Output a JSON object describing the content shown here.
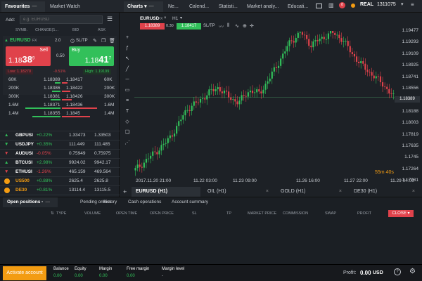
{
  "topbar": {
    "favourites": "Favourites",
    "market_watch": "Market Watch",
    "charts": "Charts",
    "tabs": [
      "Ne...",
      "Calend...",
      "Statisti...",
      "Market analy...",
      "Educati..."
    ],
    "account_type": "REAL",
    "account_number": "1311075",
    "notification_count": "8"
  },
  "left": {
    "add_label": "Add:",
    "search_placeholder": "e.g. EURUSD",
    "headers": [
      "SYMB.",
      "CHANGE(1...",
      "BID",
      "ASK"
    ],
    "ticket": {
      "symbol": "EURUSD",
      "fx": "FX",
      "volume": "2.0",
      "sltp": "SL/TP",
      "sell_label": "Sell",
      "sell_price_a": "1.18",
      "sell_price_b": "38",
      "sell_price_c": "9",
      "spread": "0.50",
      "buy_label": "Buy",
      "buy_price_a": "1.18",
      "buy_price_b": "41",
      "buy_price_c": "7",
      "low": "Low: 1.18270",
      "change": "-0.51%",
      "high": "High: 1.19199"
    },
    "depth": [
      {
        "vol": "60K",
        "bid": "1.18389",
        "ask": "1.18417",
        "vol2": "60K"
      },
      {
        "vol": "200K",
        "bid": "1.18386",
        "ask": "1.18422",
        "vol2": "200K"
      },
      {
        "vol": "300K",
        "bid": "1.18381",
        "ask": "1.18426",
        "vol2": "300K"
      },
      {
        "vol": "1.6M",
        "bid": "1.18371",
        "ask": "1.18436",
        "vol2": "1.6M"
      },
      {
        "vol": "1.4M",
        "bid": "1.18355",
        "ask": "1.1845",
        "vol2": "1.4M"
      }
    ],
    "instruments": [
      {
        "dir": "▲",
        "sym": "GBPUSI",
        "chg": "+0.22%",
        "bid": "1.33473",
        "ask": "1.33503",
        "color": "green"
      },
      {
        "dir": "▼",
        "sym": "USDJPY",
        "chg": "+0.35%",
        "bid": "111.449",
        "ask": "111.485",
        "color": "green"
      },
      {
        "dir": "▼",
        "sym": "AUDUSI",
        "chg": "-0.05%",
        "bid": "0.75949",
        "ask": "0.75975",
        "color": "red"
      },
      {
        "dir": "▲",
        "sym": "BTCUSI",
        "chg": "+2.98%",
        "bid": "9924.02",
        "ask": "9942.17",
        "color": "green"
      },
      {
        "dir": "▼",
        "sym": "ETHUSI",
        "chg": "-1.26%",
        "bid": "465.159",
        "ask": "469.564",
        "color": "red"
      },
      {
        "dir": "●",
        "sym": "US500",
        "chg": "+0.88%",
        "bid": "2625.4",
        "ask": "2625.8",
        "color": "green"
      },
      {
        "dir": "●",
        "sym": "DE30",
        "chg": "+0.81%",
        "bid": "13114.4",
        "ask": "13115.5",
        "color": "green"
      },
      {
        "dir": "●",
        "sym": "US100",
        "chg": "+1.12%",
        "bid": "6311.2",
        "ask": "6312.1",
        "color": "green"
      }
    ]
  },
  "chart": {
    "symbol": "EURUSD",
    "fx": "FX",
    "timeframe": "H1",
    "sell_price": "1.18389",
    "spread": "0.30",
    "buy_price": "1.18417",
    "sltp": "SL/TP",
    "y_ticks": [
      "1.19477",
      "1.19293",
      "1.19109",
      "1.18925",
      "1.18741",
      "1.18556",
      "1.18389",
      "1.18188",
      "1.18003",
      "1.17819",
      "1.17635",
      "1.1745",
      "1.17264",
      "1.17081"
    ],
    "x_ticks": [
      "2017.11.20 21:00",
      "11.22 03:00",
      "11.23 09:00",
      "11.26 16:00",
      "11.27 22:00",
      "11.29 04:00"
    ],
    "countdown": "55m 40s",
    "tabs": [
      "EURUSD (H1)",
      "OIL (H1)",
      "GOLD (H1)",
      "DE30 (H1)"
    ],
    "current_price": "1.18389"
  },
  "chart_data": {
    "type": "candlestick",
    "x": [
      "2017.11.20 21:00",
      "11.22 03:00",
      "11.23 09:00",
      "11.26 16:00",
      "11.27 22:00",
      "11.29 04:00"
    ],
    "values": [
      1.172,
      1.1735,
      1.175,
      1.1765,
      1.179,
      1.182,
      1.183,
      1.1845,
      1.1855,
      1.184,
      1.183,
      1.185,
      1.1845,
      1.187,
      1.19,
      1.193,
      1.1945,
      1.1925,
      1.1935,
      1.1945,
      1.1935,
      1.191,
      1.189,
      1.1875,
      1.186,
      1.1839
    ],
    "ylim": [
      1.17081,
      1.19477
    ]
  },
  "positions": {
    "tabs": [
      "Open positions",
      "Pending orders",
      "History",
      "Cash operations",
      "Account summary"
    ],
    "columns": [
      "TYPE",
      "VOLUME",
      "OPEN TIME",
      "OPEN PRICE",
      "SL",
      "TP",
      "MARKET PRICE",
      "COMMISSION",
      "SWAP",
      "PROFIT"
    ],
    "close_label": "CLOSE"
  },
  "footer": {
    "activate": "Activate account",
    "balance_label": "Balance",
    "balance": "0.00",
    "equity_label": "Equity",
    "equity": "0.00",
    "margin_label": "Margin",
    "margin": "0.00",
    "free_margin_label": "Free margin",
    "free_margin": "0.00",
    "margin_level_label": "Margin level",
    "margin_level": "-",
    "profit_label": "Profit:",
    "profit": "0.00",
    "currency": "USD"
  },
  "colors": {
    "green": "#32c05a",
    "red": "#e0424b",
    "orange": "#f39c12"
  }
}
